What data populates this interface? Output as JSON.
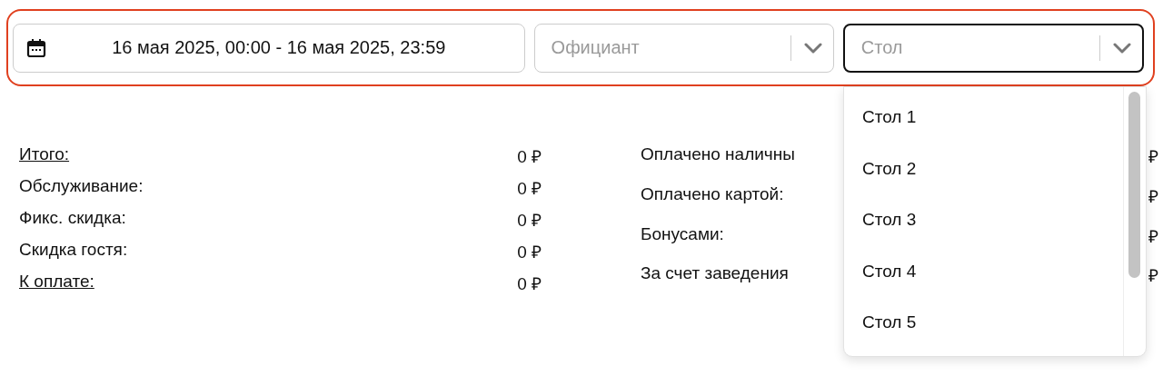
{
  "filters": {
    "date_range": "16 мая 2025, 00:00 - 16 мая 2025, 23:59",
    "selects": [
      {
        "placeholder": "Официант",
        "focused": false
      },
      {
        "placeholder": "Стол",
        "focused": true
      }
    ]
  },
  "summary_left": [
    {
      "label": "Итого:",
      "value": "0 ₽",
      "underlined": true
    },
    {
      "label": "Обслуживание:",
      "value": "0 ₽",
      "underlined": false
    },
    {
      "label": "Фикс. скидка:",
      "value": "0 ₽",
      "underlined": false
    },
    {
      "label": "Скидка гостя:",
      "value": "0 ₽",
      "underlined": false
    },
    {
      "label": "К оплате:",
      "value": "0 ₽",
      "underlined": true
    }
  ],
  "summary_right": [
    {
      "label": "Оплачено наличны",
      "value": "₽"
    },
    {
      "label": "Оплачено картой:",
      "value": "₽"
    },
    {
      "label": "Бонусами:",
      "value": "₽"
    },
    {
      "label": "За счет заведения",
      "value": "₽"
    }
  ],
  "dropdown": {
    "options": [
      "Стол 1",
      "Стол 2",
      "Стол 3",
      "Стол 4",
      "Стол 5"
    ]
  }
}
